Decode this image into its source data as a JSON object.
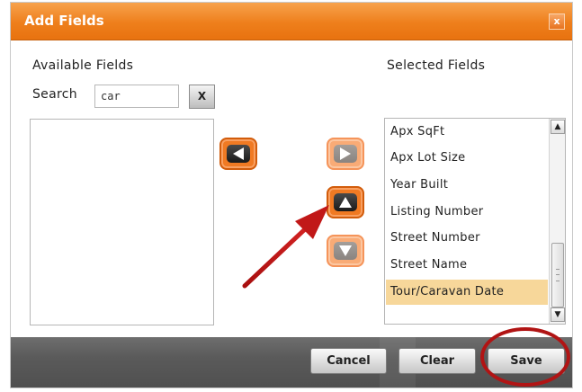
{
  "dialog": {
    "title": "Add Fields",
    "close_label": "x"
  },
  "available": {
    "heading": "Available Fields",
    "search_label": "Search",
    "search_value": "car",
    "clear_label": "X",
    "items": []
  },
  "selected": {
    "heading": "Selected Fields",
    "items": [
      {
        "label": "Apx SqFt",
        "selected": false
      },
      {
        "label": "Apx Lot Size",
        "selected": false
      },
      {
        "label": "Year Built",
        "selected": false
      },
      {
        "label": "Listing Number",
        "selected": false
      },
      {
        "label": "Street Number",
        "selected": false
      },
      {
        "label": "Street Name",
        "selected": false
      },
      {
        "label": "Tour/Caravan Date",
        "selected": true
      }
    ]
  },
  "footer": {
    "cancel_label": "Cancel",
    "clear_label": "Clear",
    "save_label": "Save"
  },
  "colors": {
    "accent": "#ee7f1c",
    "selected_row": "#f7d79a",
    "annotation": "#b11414"
  },
  "icons": {
    "remove": "arrow-left-icon",
    "add": "arrow-right-icon",
    "move_up": "arrow-up-icon",
    "move_down": "arrow-down-icon"
  }
}
